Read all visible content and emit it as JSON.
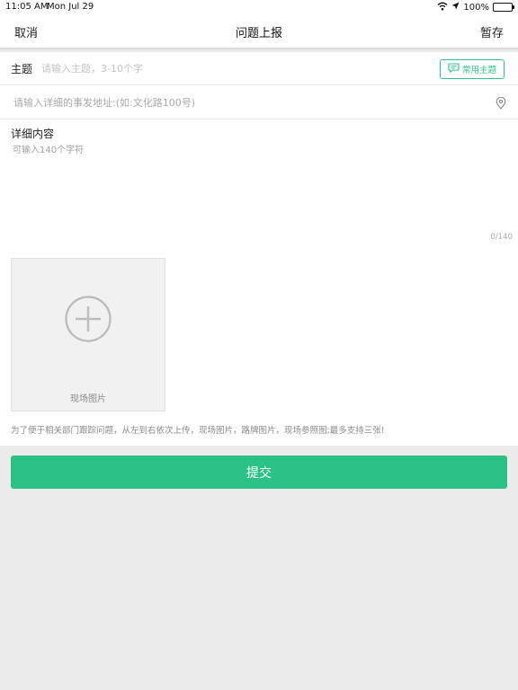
{
  "status_bar": {
    "time": "11:05 AM",
    "date": "Mon Jul 29",
    "battery": "100%",
    "icons": [
      "wifi-icon",
      "location-arrow-icon",
      "battery-icon"
    ]
  },
  "navbar": {
    "cancel_label": "取消",
    "title": "问题上报",
    "save_draft_label": "暂存"
  },
  "form": {
    "subject_label": "主题",
    "subject_placeholder": "请输入主题，3-10个字",
    "subject_value": "",
    "common_subject_label": "常用主题",
    "address_placeholder": "请输入详细的事发地址:(如:文化路100号)",
    "address_value": "",
    "detail_title": "详细内容",
    "detail_placeholder": "可输入140个字符",
    "detail_value": "",
    "char_count": "0/140",
    "photo_label": "现场图片",
    "upload_hint": "为了便于相关部门跟踪问题，从左到右依次上传，现场图片，路牌图片，现场参照图;最多支持三张!"
  },
  "submit_label": "提交",
  "colors": {
    "accent": "#2bc286",
    "page_bg": "#ececec"
  }
}
